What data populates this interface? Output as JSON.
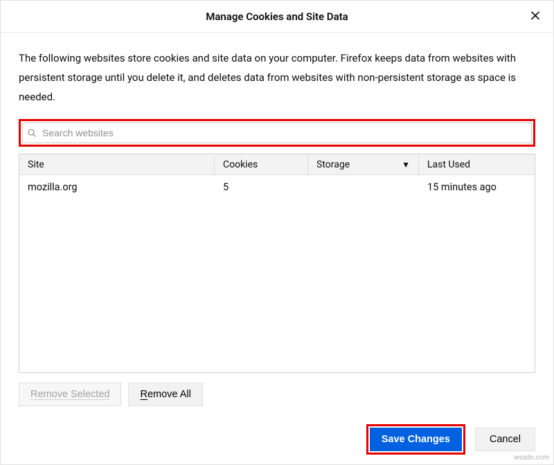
{
  "header": {
    "title": "Manage Cookies and Site Data"
  },
  "description": "The following websites store cookies and site data on your computer. Firefox keeps data from websites with persistent storage until you delete it, and deletes data from websites with non-persistent storage as space is needed.",
  "search": {
    "placeholder": "Search websites",
    "value": ""
  },
  "table": {
    "columns": {
      "site": "Site",
      "cookies": "Cookies",
      "storage": "Storage",
      "last_used": "Last Used"
    },
    "sort_column": "storage",
    "sort_dir": "desc",
    "rows": [
      {
        "site": "mozilla.org",
        "cookies": "5",
        "storage": "",
        "last_used": "15 minutes ago"
      }
    ]
  },
  "buttons": {
    "remove_selected_prefix": "R",
    "remove_selected_rest": "emove Selected",
    "remove_all_prefix": "R",
    "remove_all_rest": "emove All",
    "save": "Save Changes",
    "cancel": "Cancel"
  },
  "watermark": "wsxdn.com"
}
